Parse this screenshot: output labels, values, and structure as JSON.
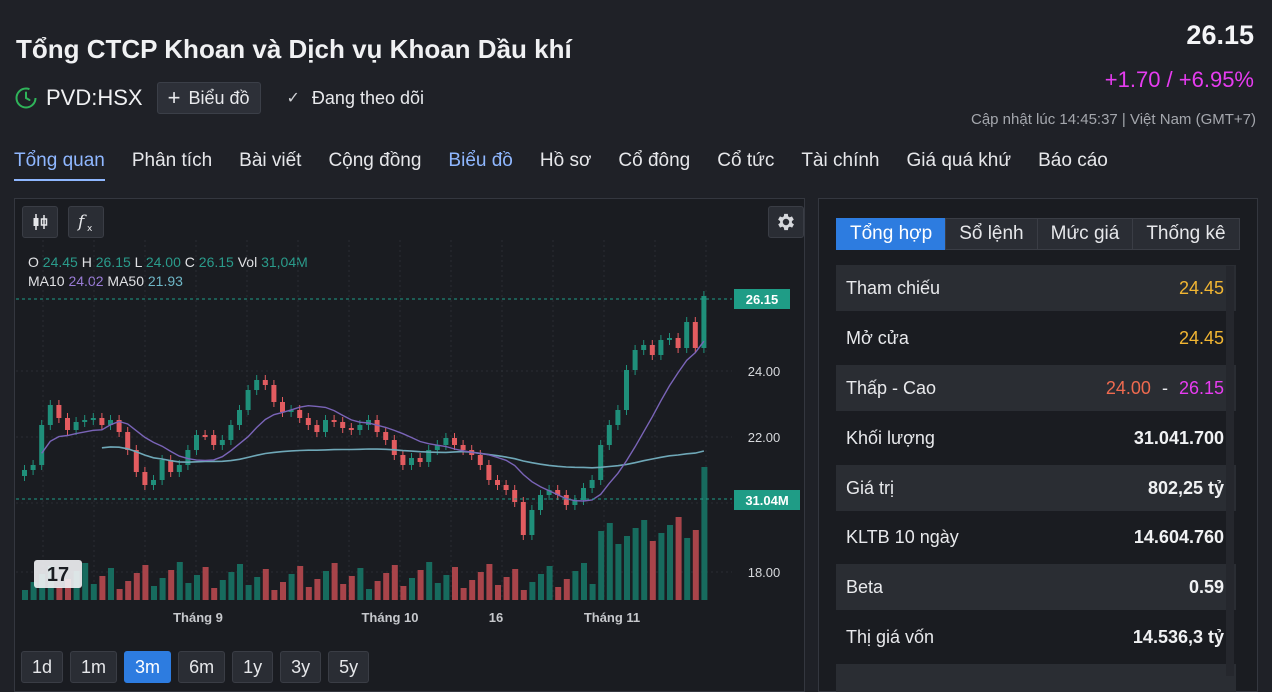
{
  "header": {
    "company_name": "Tổng CTCP Khoan và Dịch vụ Khoan Dầu khí",
    "ticker": "PVD:HSX",
    "chart_button_label": "Biểu đồ",
    "follow_label": "Đang theo dõi",
    "price": "26.15",
    "change": "+1.70 / +6.95%",
    "updated": "Cập nhật lúc  14:45:37 | Việt Nam (GMT+7)",
    "change_color": "#e63cf0"
  },
  "nav": {
    "tabs": [
      "Tổng quan",
      "Phân tích",
      "Bài viết",
      "Cộng đồng",
      "Biểu đồ",
      "Hồ sơ",
      "Cổ đông",
      "Cổ tức",
      "Tài chính",
      "Giá quá khứ",
      "Báo cáo"
    ]
  },
  "chart": {
    "ohlc": {
      "o_label": "O",
      "o": "24.45",
      "h_label": "H",
      "h": "26.15",
      "l_label": "L",
      "l": "24.00",
      "c_label": "C",
      "c": "26.15",
      "vol_label": "Vol",
      "vol": "31,04M"
    },
    "ma": {
      "ma10_label": "MA10",
      "ma10": "24.02",
      "ma50_label": "MA50",
      "ma50": "21.93"
    },
    "price_tag": "26.15",
    "volume_tag": "31.04M",
    "y_ticks": [
      "24.00",
      "22.00",
      "18.00"
    ],
    "x_ticks": [
      "Tháng 9",
      "Tháng 10",
      "16",
      "Tháng 11"
    ],
    "logo_text": "17",
    "ranges": [
      "1d",
      "1m",
      "3m",
      "6m",
      "1y",
      "3y",
      "5y"
    ],
    "active_range": "3m",
    "up_color": "#1f8f7a",
    "down_color": "#e35c60"
  },
  "chart_data": {
    "type": "candlestick",
    "y_ticks": [
      24.0,
      22.0,
      18.0
    ],
    "x_ticks": [
      "Tháng 9",
      "Tháng 10",
      "16",
      "Tháng 11"
    ],
    "last_price": 26.15,
    "last_volume": "31.04M",
    "series": [
      {
        "name": "MA10",
        "last": 24.02
      },
      {
        "name": "MA50",
        "last": 21.93
      }
    ]
  },
  "stats": {
    "tabs": [
      "Tổng hợp",
      "Sổ lệnh",
      "Mức giá",
      "Thống kê"
    ],
    "active_tab": "Tổng hợp",
    "rows": [
      {
        "label": "Tham chiếu",
        "value": "24.45"
      },
      {
        "label": "Mở cửa",
        "value": "24.45"
      },
      {
        "label": "Thấp - Cao",
        "low": "24.00",
        "sep": "-",
        "high": "26.15"
      },
      {
        "label": "Khối lượng",
        "value": "31.041.700"
      },
      {
        "label": "Giá trị",
        "value": "802,25 tỷ"
      },
      {
        "label": "KLTB 10 ngày",
        "value": "14.604.760"
      },
      {
        "label": "Beta",
        "value": "0.59"
      },
      {
        "label": "Thị giá vốn",
        "value": "14.536,3 tỷ"
      }
    ],
    "low_color": "#ee6a4f",
    "high_color": "#e63cf0",
    "ref_color": "#f2b632"
  }
}
